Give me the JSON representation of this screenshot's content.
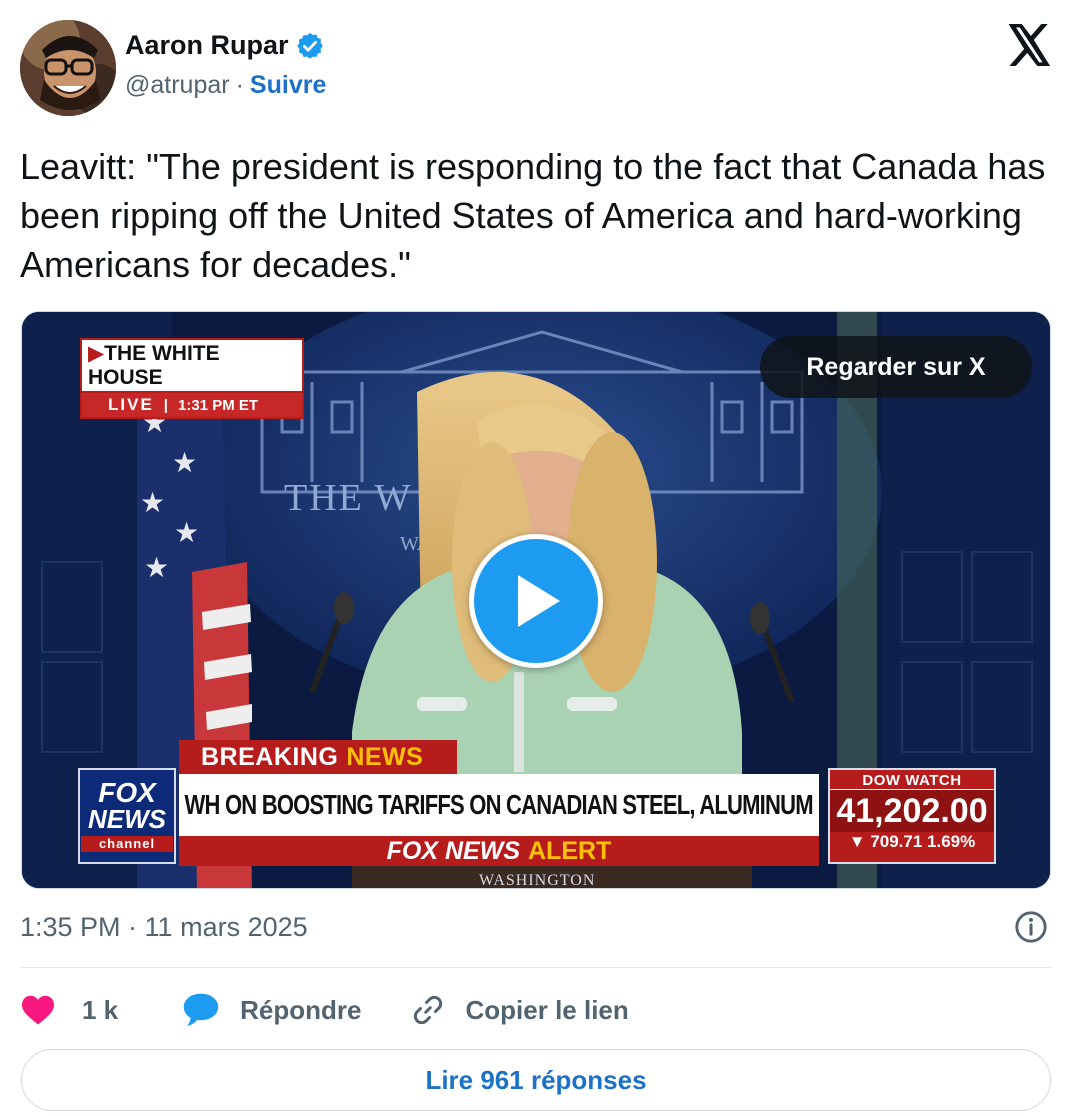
{
  "author": {
    "name": "Aaron Rupar",
    "handle": "@atrupar",
    "separator": "·",
    "follow_label": "Suivre",
    "verified": true
  },
  "tweet": {
    "text": "Leavitt: \"The president is responding to the fact that Canada has been ripping off the United States of America and hard-working Americans for decades.\"",
    "timestamp": "1:35 PM · 11 mars 2025"
  },
  "media": {
    "watch_label": "Regarder sur X",
    "wh_badge_title": "THE WHITE HOUSE",
    "wh_badge_live": "LIVE",
    "wh_badge_time": "1:31 PM ET",
    "backdrop_text": "THE W      OUSE",
    "backdrop_subtext": "WA",
    "breaking": "BREAKING",
    "breaking_news": "NEWS",
    "headline": "WH ON BOOSTING TARIFFS ON CANADIAN STEEL, ALUMINUM",
    "alert_prefix": "FOX NEWS",
    "alert_word": "ALERT",
    "fox_line1": "FOX",
    "fox_line2": "NEWS",
    "fox_line3": "channel",
    "dow_title": "DOW WATCH",
    "dow_value": "41,202.00",
    "dow_change": "709.71",
    "dow_pct": "1.69%",
    "location": "WASHINGTON",
    "icon": "play-icon"
  },
  "actions": {
    "likes": "1 k",
    "reply_label": "Répondre",
    "copy_label": "Copier le lien"
  },
  "replies_button": "Lire 961 réponses",
  "colors": {
    "accent": "#1d9bf0",
    "link": "#1d72c8",
    "like": "#f91880",
    "muted": "#536471"
  }
}
